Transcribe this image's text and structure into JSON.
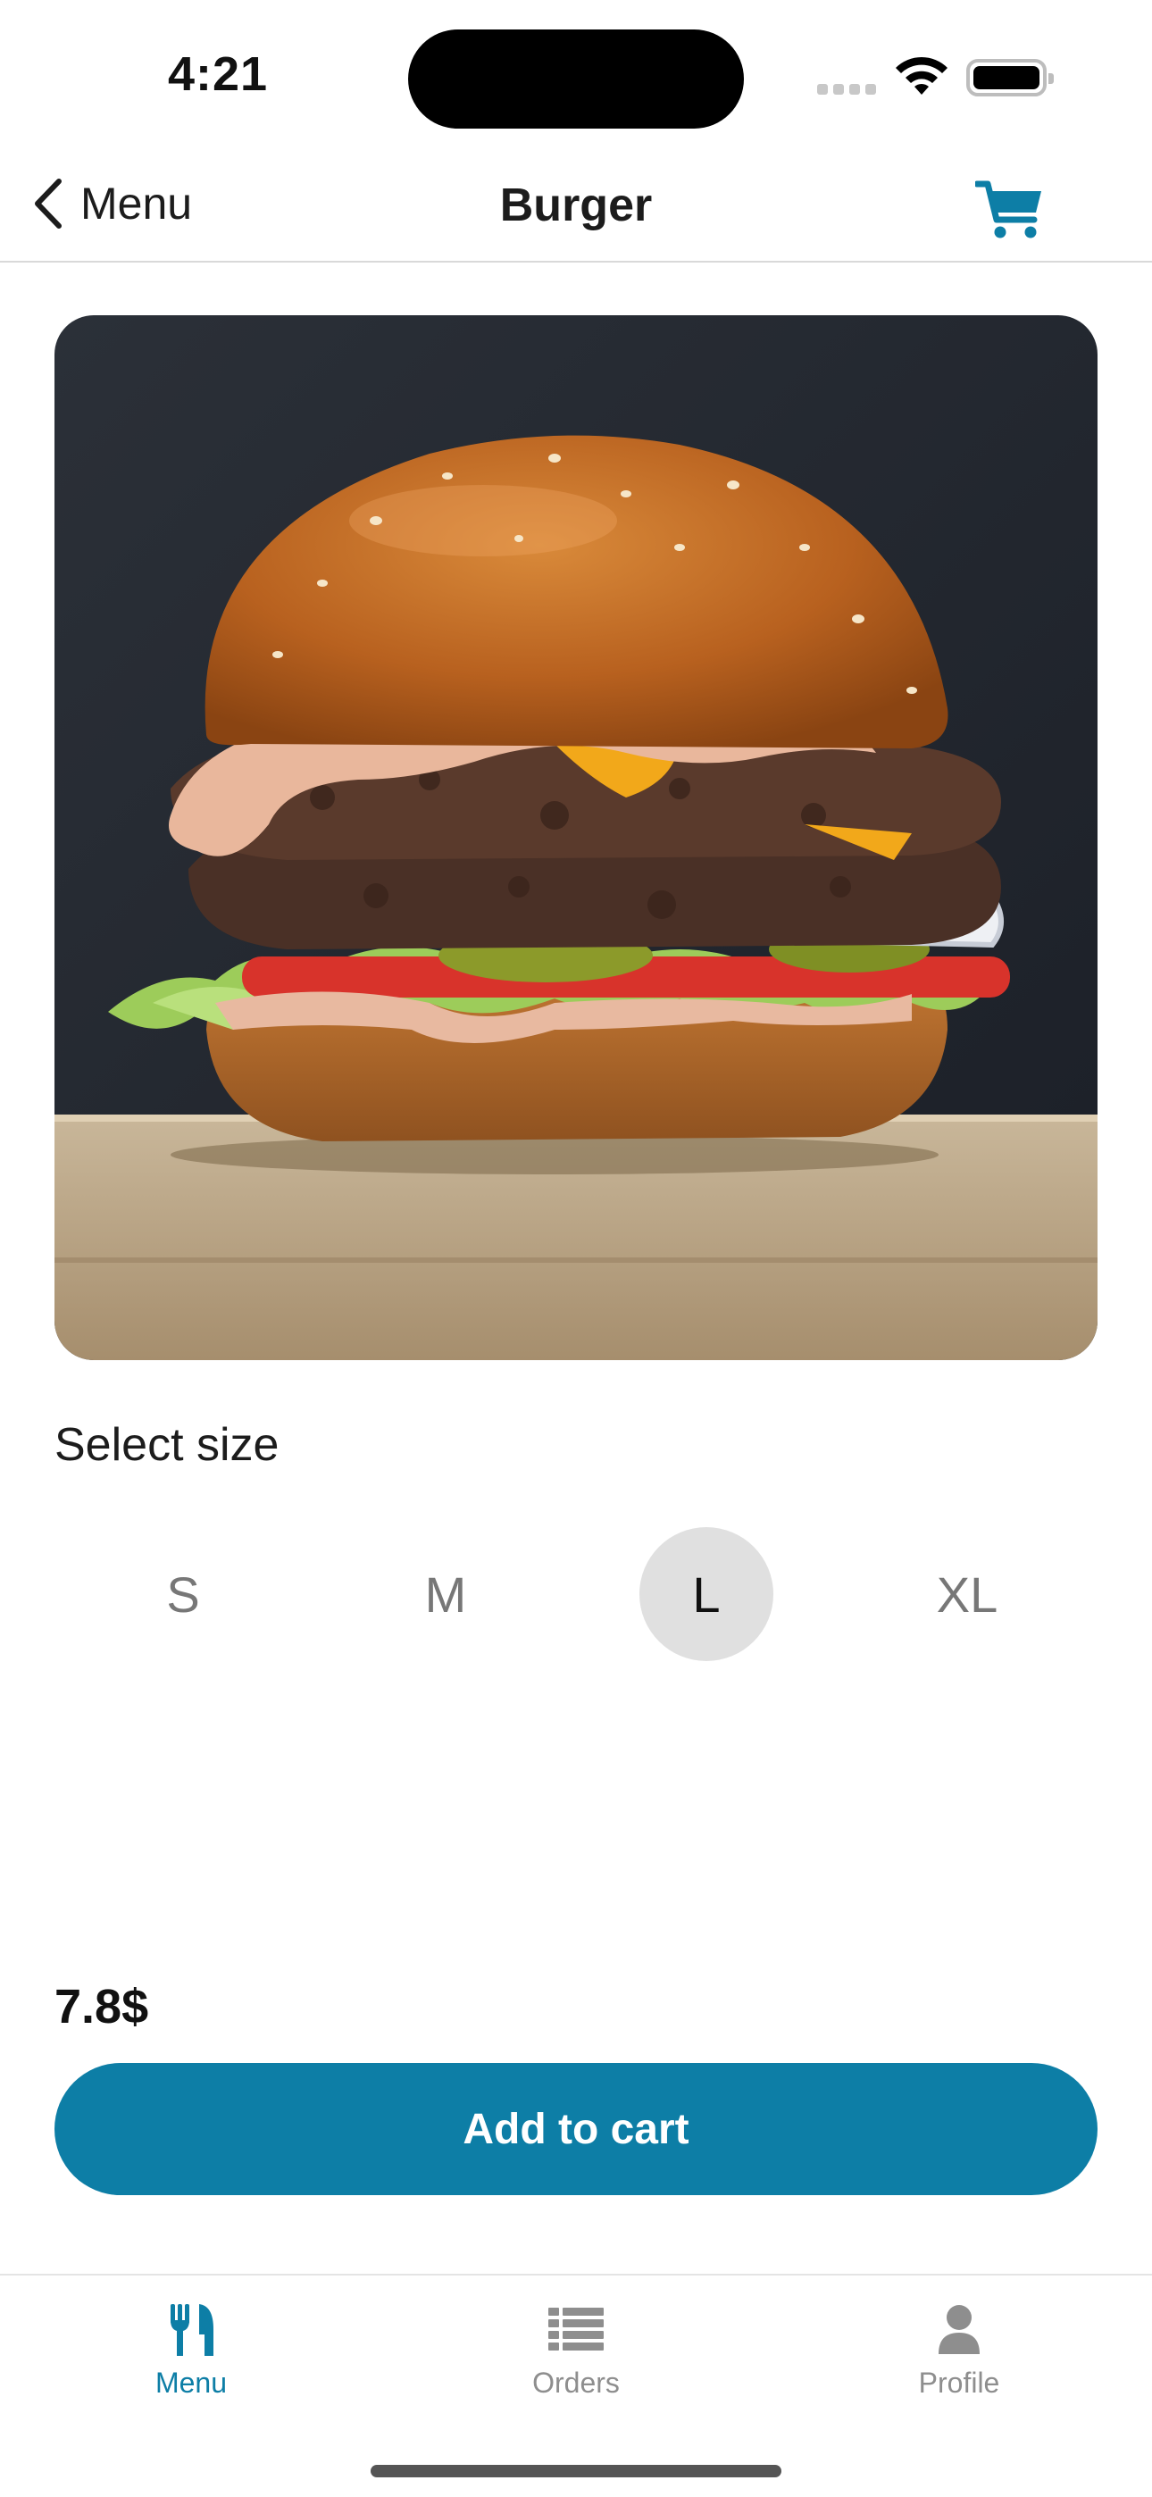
{
  "status_bar": {
    "time": "4:21",
    "icons": [
      "cellular-signal-icon",
      "wifi-icon",
      "battery-icon"
    ]
  },
  "nav": {
    "back_label": "Menu",
    "title": "Burger",
    "back_icon": "chevron-left-icon",
    "cart_icon": "shopping-cart-icon"
  },
  "product": {
    "image_description": "burger-photo"
  },
  "size_selector": {
    "label": "Select size",
    "options": [
      "S",
      "M",
      "L",
      "XL"
    ],
    "selected": "L"
  },
  "price": "7.8$",
  "cta": {
    "label": "Add to cart"
  },
  "tabs": [
    {
      "label": "Menu",
      "icon": "fork-knife-icon",
      "active": true
    },
    {
      "label": "Orders",
      "icon": "list-icon",
      "active": false
    },
    {
      "label": "Profile",
      "icon": "person-icon",
      "active": false
    }
  ],
  "colors": {
    "accent": "#0d7ea6",
    "selected_size_bg": "#e0e0e0",
    "inactive_tab": "#8e8e8e"
  }
}
